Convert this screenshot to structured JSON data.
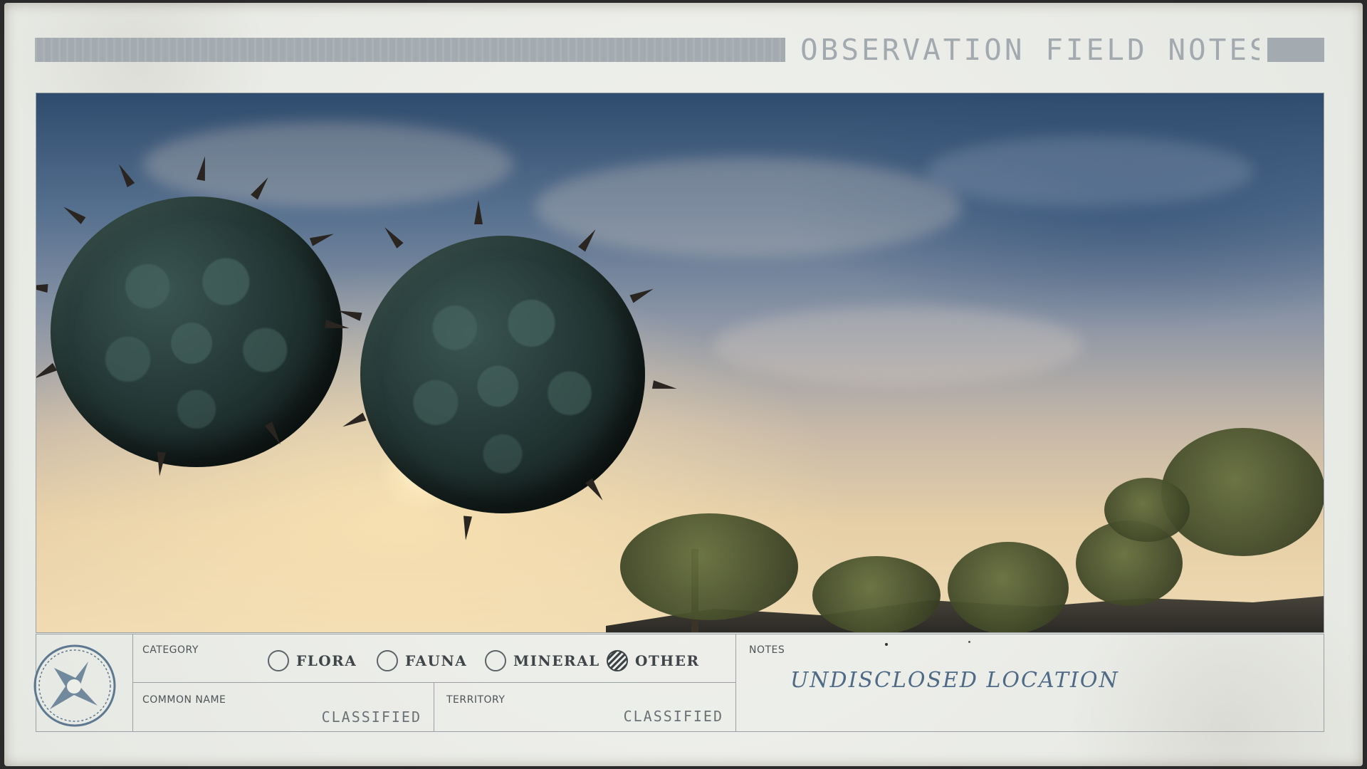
{
  "header": {
    "title": "OBSERVATION FIELD NOTES"
  },
  "photo": {
    "icon": "photo-scene"
  },
  "form": {
    "emblem_icon": "compass-star-icon",
    "category": {
      "label": "CATEGORY",
      "options": [
        {
          "label": "FLORA",
          "selected": false
        },
        {
          "label": "FAUNA",
          "selected": false
        },
        {
          "label": "MINERAL",
          "selected": false
        },
        {
          "label": "OTHER",
          "selected": true
        }
      ]
    },
    "common_name": {
      "label": "COMMON NAME",
      "value": "CLASSIFIED"
    },
    "territory": {
      "label": "TERRITORY",
      "value": "CLASSIFIED"
    },
    "notes": {
      "label": "NOTES",
      "value": "UNDISCLOSED LOCATION"
    }
  },
  "colors": {
    "paper": "#eceeea",
    "header_bar": "#a3abb0",
    "notes_ink": "#4f6a86",
    "rule": "#9aa0a4"
  }
}
